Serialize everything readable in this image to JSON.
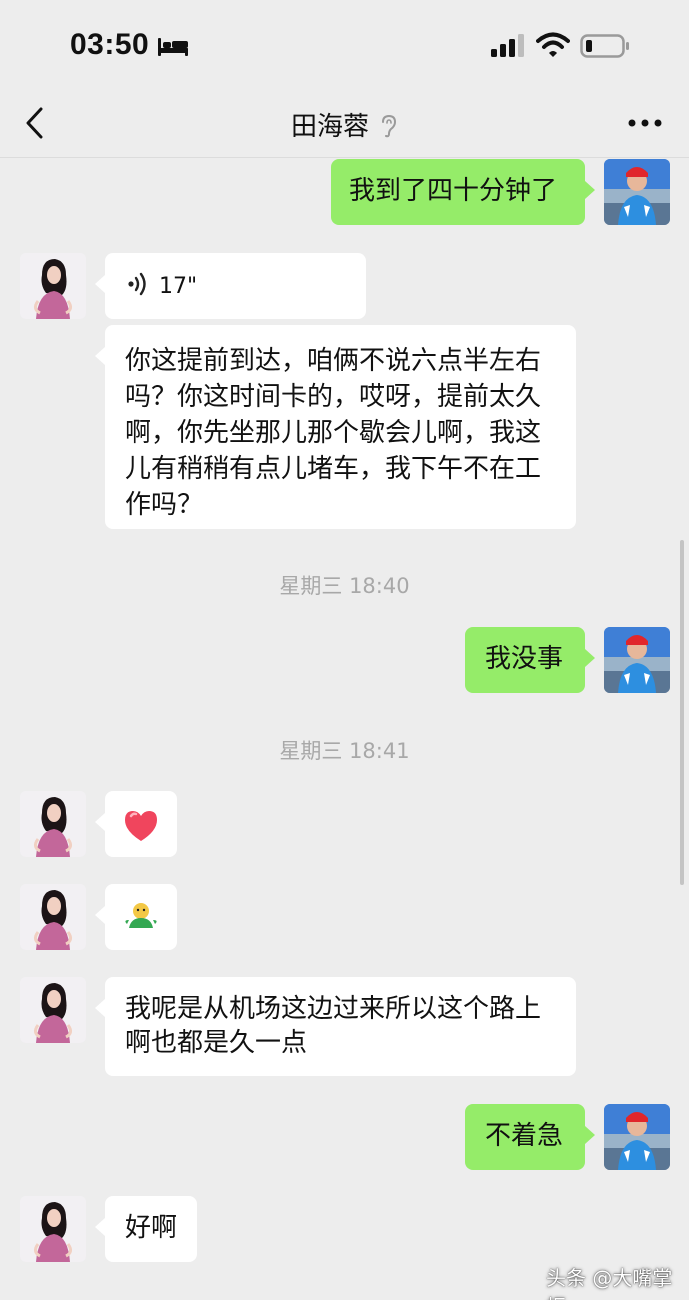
{
  "status_bar": {
    "time": "03:50",
    "icons": [
      "bed-icon",
      "signal-icon",
      "wifi-icon",
      "battery-icon"
    ]
  },
  "nav": {
    "title": "田海蓉",
    "icons": [
      "back-icon",
      "ear-icon",
      "more-icon"
    ]
  },
  "messages": [
    {
      "sender": "me",
      "type": "text",
      "text": "我到了四十分钟了"
    },
    {
      "sender": "her",
      "type": "voice",
      "duration": "17\""
    },
    {
      "sender": "her",
      "type": "text",
      "text": "你这提前到达，咱俩不说六点半左右吗？你这时间卡的，哎呀，提前太久啊，你先坐那儿那个歇会儿啊，我这儿有稍稍有点儿堵车，我下午不在工作吗？"
    },
    {
      "type": "timestamp",
      "text": "星期三 18:40"
    },
    {
      "sender": "me",
      "type": "text",
      "text": "我没事"
    },
    {
      "type": "timestamp",
      "text": "星期三 18:41"
    },
    {
      "sender": "her",
      "type": "emoji",
      "name": "heart-emoji"
    },
    {
      "sender": "her",
      "type": "emoji",
      "name": "seedling-sticker-emoji"
    },
    {
      "sender": "her",
      "type": "text",
      "text": "我呢是从机场这边过来所以这个路上啊也都是久一点"
    },
    {
      "sender": "me",
      "type": "text",
      "text": "不着急"
    },
    {
      "sender": "her",
      "type": "text",
      "text": "好啊"
    }
  ],
  "watermark": "头条 @大嘴掌柜",
  "colors": {
    "background": "#ededed",
    "bubble_right": "#95ec69",
    "bubble_left": "#ffffff",
    "timestamp": "#a8a8a8"
  }
}
